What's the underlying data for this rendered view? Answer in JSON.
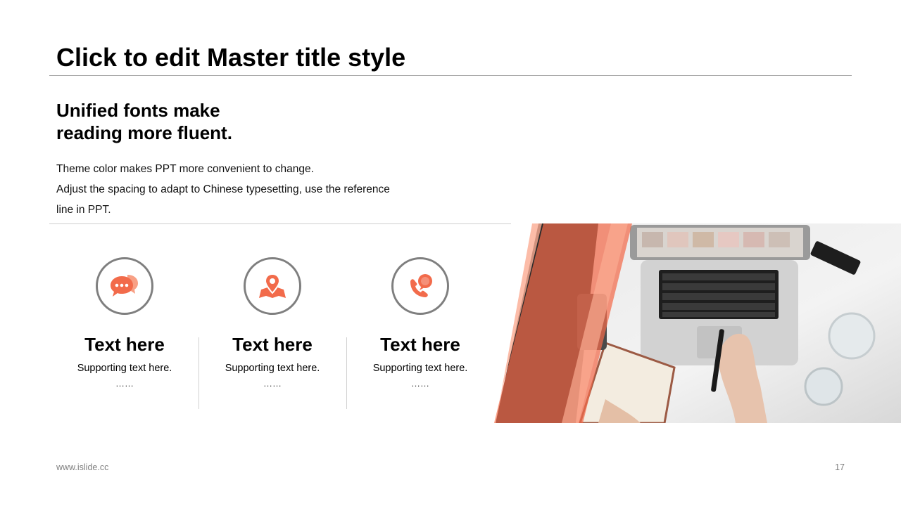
{
  "slide": {
    "title": "Click to edit Master title style",
    "subheading_lines": [
      "Unified fonts make",
      "reading more fluent."
    ],
    "body_lines": [
      "Theme color makes PPT more convenient to change.",
      "Adjust the spacing to adapt to Chinese typesetting, use the reference",
      "line in PPT."
    ],
    "features": [
      {
        "icon": "chat-bubbles-icon",
        "title": "Text here",
        "supporting": "Supporting text here.",
        "ellipsis": "……"
      },
      {
        "icon": "map-pin-icon",
        "title": "Text here",
        "supporting": "Supporting text here.",
        "ellipsis": "……"
      },
      {
        "icon": "phone-call-icon",
        "title": "Text here",
        "supporting": "Supporting text here.",
        "ellipsis": "……"
      }
    ],
    "footer": {
      "url": "www.islide.cc",
      "page_number": "17"
    }
  },
  "colors": {
    "accent": "#f26b4b",
    "accent_light": "#fbab92",
    "accent_dark": "#b25038",
    "icon_ring": "#7f7f7f",
    "rule": "#a6a6a6"
  }
}
